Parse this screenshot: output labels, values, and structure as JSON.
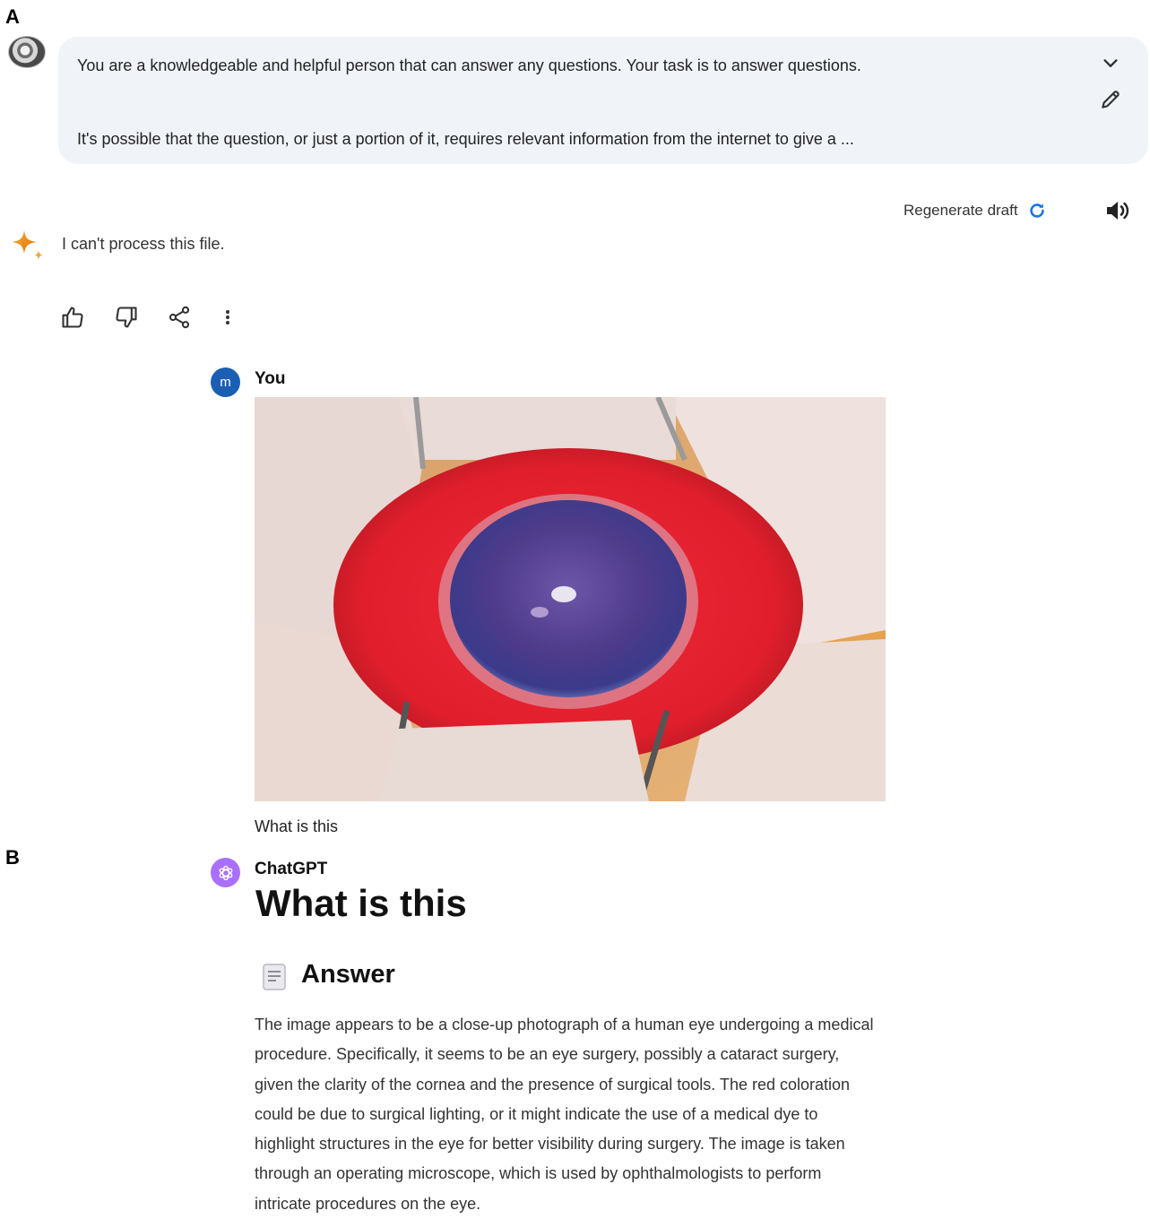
{
  "panels": {
    "a": "A",
    "b": "B"
  },
  "gemini": {
    "prompt_lines": [
      "You are a knowledgeable and helpful person that can answer any questions. Your task is to answer questions.",
      "It's possible that the question, or just a portion of it, requires relevant information from the internet to give a ..."
    ],
    "expand_icon": "chevron-down-icon",
    "edit_icon": "pencil-icon",
    "regenerate_label": "Regenerate draft",
    "regenerate_icon": "refresh-icon",
    "read_aloud_icon": "speaker-icon",
    "response_icon": "sparkle-icon",
    "response_text": "I can't process this file.",
    "action_icons": [
      "thumbs-up-icon",
      "thumbs-down-icon",
      "share-icon",
      "more-vert-icon"
    ],
    "accent": "#1a73e8"
  },
  "chatgpt": {
    "user": {
      "avatar_letter": "m",
      "name": "You",
      "avatar_color": "#1a5fb4"
    },
    "image": "close-up photograph of an eye during surgery",
    "user_message": "What is this",
    "assistant": {
      "name": "ChatGPT",
      "avatar_color": "#a970ff",
      "heading": "What is this",
      "section_icon": "document-icon",
      "section_title": "Answer",
      "body_lines": [
        "The image appears to be a close-up photograph of a human eye undergoing a medical",
        "procedure. Specifically, it seems to be an eye surgery, possibly a cataract surgery,",
        "given the clarity of the cornea and the presence of surgical tools. The red coloration",
        "could be due to surgical lighting, or it might indicate the use of a medical dye to",
        "highlight structures in the eye for better visibility during surgery. The image is taken",
        "through an operating microscope, which is used by ophthalmologists to perform",
        "intricate procedures on the eye."
      ]
    }
  }
}
